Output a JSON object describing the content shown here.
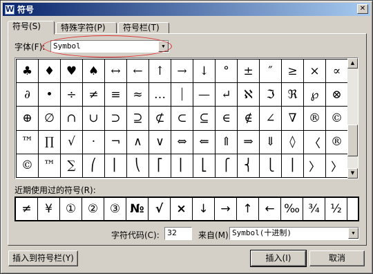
{
  "window": {
    "title": "符号",
    "app_icon_letter": "W",
    "close_glyph": "✕"
  },
  "tabs": [
    {
      "label": "符号(S)",
      "active": true
    },
    {
      "label": "特殊字符(P)",
      "active": false
    },
    {
      "label": "符号栏(T)",
      "active": false
    }
  ],
  "font": {
    "label": "字体(F):",
    "value": "Symbol"
  },
  "symbol_grid": {
    "rows": [
      [
        "♣",
        "♦",
        "♥",
        "♠",
        "↔",
        "←",
        "↑",
        "→",
        "↓",
        "°",
        "±",
        "″",
        "≥",
        "×",
        "∝"
      ],
      [
        "∂",
        "•",
        "÷",
        "≠",
        "≡",
        "≈",
        "…",
        "⏐",
        "—",
        "↵",
        "ℵ",
        "ℑ",
        "ℜ",
        "℘",
        "⊗"
      ],
      [
        "⊕",
        "∅",
        "∩",
        "∪",
        "⊃",
        "⊇",
        "⊄",
        "⊂",
        "⊆",
        "∈",
        "∉",
        "∠",
        "∇",
        "®",
        "©"
      ],
      [
        "™",
        "∏",
        "√",
        "·",
        "¬",
        "∧",
        "∨",
        "⇔",
        "⇐",
        "⇑",
        "⇒",
        "⇓",
        "◊",
        "〈",
        "®"
      ],
      [
        "©",
        "™",
        "∑",
        "⎛",
        "⎜",
        "⎝",
        "⎡",
        "⎢",
        "⎣",
        "⎧",
        "⎨",
        "⎩",
        "⎪",
        "〉",
        "〉"
      ]
    ]
  },
  "recent": {
    "label": "近期使用过的符号(R):",
    "symbols": [
      "≠",
      "¥",
      "①",
      "②",
      "③",
      "№",
      "√",
      "×",
      "↓",
      "→",
      "↑",
      "←",
      "‰",
      "¾",
      "½"
    ]
  },
  "char_code": {
    "label": "字符代码(C):",
    "value": "32"
  },
  "from": {
    "label": "来自(M)",
    "value": "Symbol(十进制)"
  },
  "buttons": {
    "insert_to_bar": "插入到符号栏(Y)",
    "insert": "插入(I)",
    "cancel": "取消"
  }
}
